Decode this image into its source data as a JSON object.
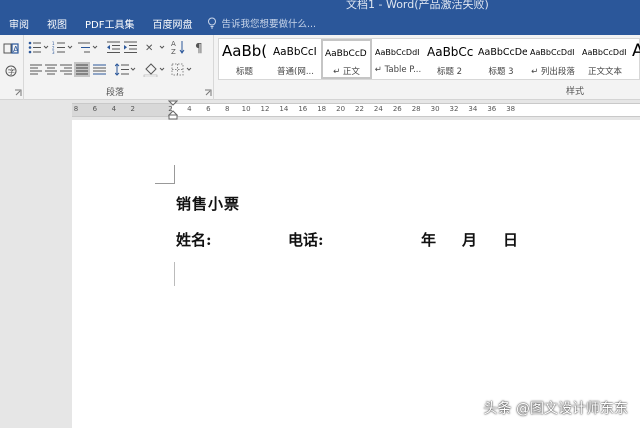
{
  "window": {
    "title": "文档1 - Word(产品激活失败)"
  },
  "tabs": [
    "审阅",
    "视图",
    "PDF工具集",
    "百度网盘"
  ],
  "tell_me": {
    "placeholder": "告诉我您想要做什么..."
  },
  "ribbon": {
    "paragraph_group_label": "段落",
    "styles_group_label": "样式",
    "styles": [
      {
        "sample": "AaBb(",
        "name": "标题"
      },
      {
        "sample": "AaBbCcI",
        "name": "普通(网..."
      },
      {
        "sample": "AaBbCcD",
        "name": "↵ 正文"
      },
      {
        "sample": "AaBbCcDdI",
        "name": "↵ Table P..."
      },
      {
        "sample": "AaBbCc",
        "name": "标题 2"
      },
      {
        "sample": "AaBbCcDe",
        "name": "标题 3"
      },
      {
        "sample": "AaBbCcDdI",
        "name": "↵ 列出段落"
      },
      {
        "sample": "AaBbCcDdI",
        "name": "正文文本"
      },
      {
        "sample": "A",
        "name": ""
      }
    ]
  },
  "ruler": {
    "numbers": [
      "8",
      "6",
      "4",
      "2",
      "",
      "2",
      "4",
      "6",
      "8",
      "10",
      "12",
      "14",
      "16",
      "18",
      "20",
      "22",
      "24",
      "26",
      "28",
      "30",
      "32",
      "34",
      "36",
      "38"
    ]
  },
  "document": {
    "title": "销售小票",
    "name_label": "姓名:",
    "phone_label": "电话:",
    "year": "年",
    "month": "月",
    "day": "日"
  },
  "watermark": "头条 @图文设计师东东"
}
